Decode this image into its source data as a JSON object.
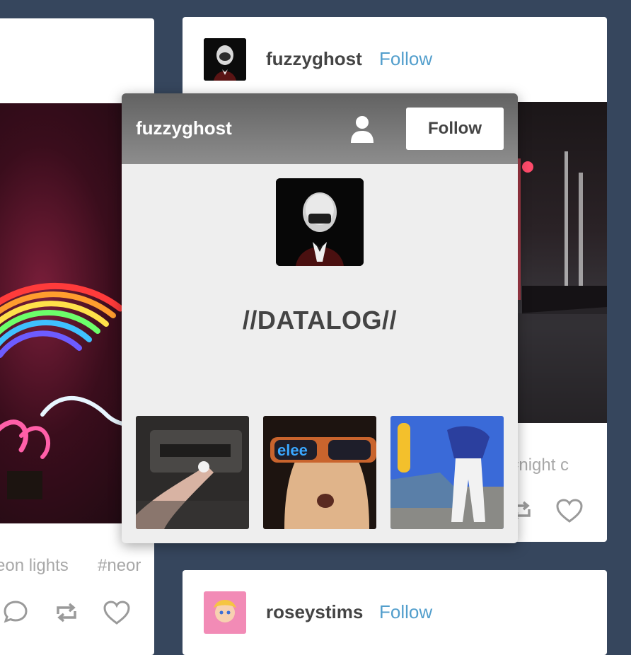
{
  "posts": {
    "left": {
      "tags": [
        "eon lights",
        "#neor"
      ]
    },
    "right_top": {
      "username": "fuzzyghost",
      "follow_label": "Follow",
      "tag_partial": "#night c"
    },
    "right_bottom": {
      "username": "roseystims",
      "follow_label": "Follow"
    }
  },
  "popover": {
    "username": "fuzzyghost",
    "follow_label": "Follow",
    "blog_title": "//DATALOG//",
    "thumbnails": [
      "thumb-hand-device",
      "thumb-sunglasses-face",
      "thumb-dancer-car"
    ]
  },
  "colors": {
    "background": "#36465d",
    "follow_link": "#529ecc",
    "popover_header_top": "#626262",
    "popover_body": "#eeeeee"
  },
  "icons": [
    "comment-icon",
    "reblog-icon",
    "heart-icon",
    "user-icon"
  ]
}
